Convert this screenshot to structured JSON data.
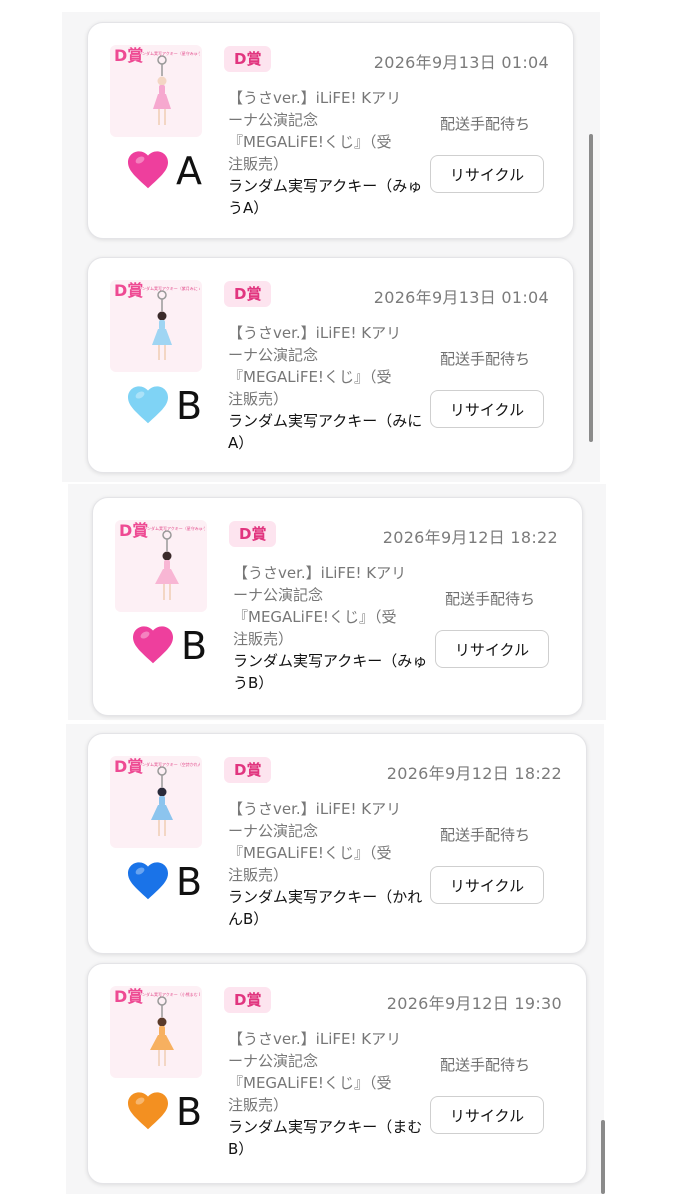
{
  "cards": [
    {
      "badge": "D賞",
      "datetime": "2026年9月13日 01:04",
      "title": "【うさver.】iLiFE! Kアリーナ公演記念『MEGALiFE!くじ』（受注販売）",
      "item": "ランダム実写アクキー（みゅうA）",
      "status": "配送手配待ち",
      "button_label": "リサイクル",
      "thumb_mark": "D賞",
      "thumb_caption": "ランダム実写アクキー（星守みゅう A）",
      "outfit_color": "#f6a8cf",
      "heart_color": "#ee3f9d",
      "heart_emoji": "pink-heart-icon",
      "label_letter": "A"
    },
    {
      "badge": "D賞",
      "datetime": "2026年9月13日 01:04",
      "title": "【うさver.】iLiFE! Kアリーナ公演記念『MEGALiFE!くじ』（受注販売）",
      "item": "ランダム実写アクキー（みにA）",
      "status": "配送手配待ち",
      "button_label": "リサイクル",
      "thumb_mark": "D賞",
      "thumb_caption": "ランダム実写アクキー（紫月みに A）",
      "outfit_color": "#9fd5f3",
      "heart_color": "#7fd3f5",
      "heart_emoji": "light-blue-heart-icon",
      "label_letter": "B"
    },
    {
      "badge": "D賞",
      "datetime": "2026年9月12日 18:22",
      "title": "【うさver.】iLiFE! Kアリーナ公演記念『MEGALiFE!くじ』（受注販売）",
      "item": "ランダム実写アクキー（みゅうB）",
      "status": "配送手配待ち",
      "button_label": "リサイクル",
      "thumb_mark": "D賞",
      "thumb_caption": "ランダム実写アクキー（星守みゅう B）",
      "outfit_color": "#f8b6d4",
      "heart_color": "#ee3f9d",
      "heart_emoji": "pink-heart-icon",
      "label_letter": "B"
    },
    {
      "badge": "D賞",
      "datetime": "2026年9月12日 18:22",
      "title": "【うさver.】iLiFE! Kアリーナ公演記念『MEGALiFE!くじ』（受注販売）",
      "item": "ランダム実写アクキー（かれんB）",
      "status": "配送手配待ち",
      "button_label": "リサイクル",
      "thumb_mark": "D賞",
      "thumb_caption": "ランダム実写アクキー（空詩かれん B）",
      "outfit_color": "#8cc4ee",
      "heart_color": "#1a73e8",
      "heart_emoji": "blue-heart-icon",
      "label_letter": "B"
    },
    {
      "badge": "D賞",
      "datetime": "2026年9月12日 19:30",
      "title": "【うさver.】iLiFE! Kアリーナ公演記念『MEGALiFE!くじ』（受注販売）",
      "item": "ランダム実写アクキー（まむB）",
      "status": "配送手配待ち",
      "button_label": "リサイクル",
      "thumb_mark": "D賞",
      "thumb_caption": "ランダム実写アクキー（小熊まむ B）",
      "outfit_color": "#f7b060",
      "heart_color": "#f39021",
      "heart_emoji": "orange-heart-icon",
      "label_letter": "B"
    }
  ]
}
